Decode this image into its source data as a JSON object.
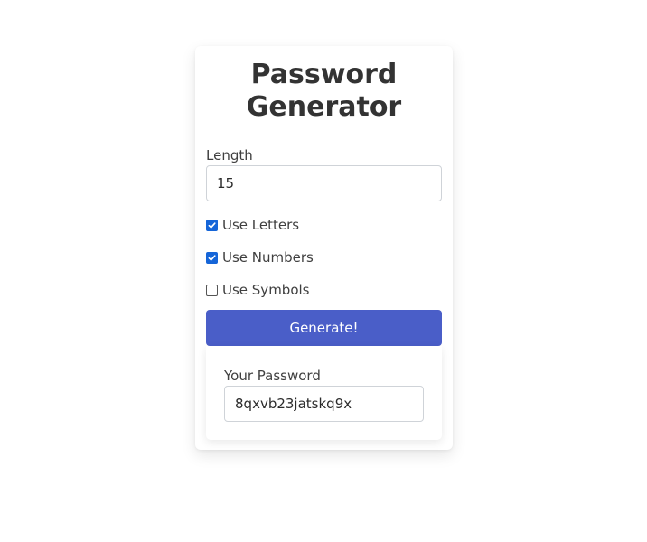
{
  "app": {
    "title": "Password Generator"
  },
  "form": {
    "length_label": "Length",
    "length_value": "15",
    "options": [
      {
        "label": "Use Letters",
        "checked": true
      },
      {
        "label": "Use Numbers",
        "checked": true
      },
      {
        "label": "Use Symbols",
        "checked": false
      }
    ],
    "generate_label": "Generate!"
  },
  "result": {
    "label": "Your Password",
    "password": "8qxvb23jatskq9x"
  },
  "colors": {
    "button": "#4a5ec8",
    "checkbox_checked": "#1565d8"
  }
}
